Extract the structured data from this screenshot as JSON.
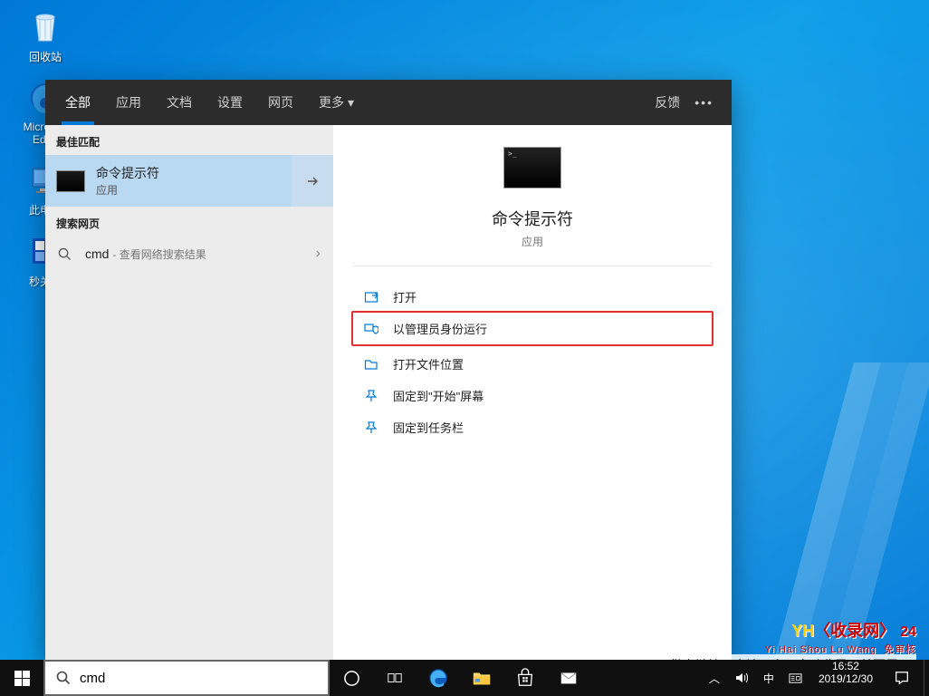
{
  "desktop": {
    "icons": [
      {
        "name": "recycle-bin",
        "label": "回收站"
      },
      {
        "name": "edge",
        "label": "Microsoft Edge"
      },
      {
        "name": "this-pc",
        "label": "此电脑"
      },
      {
        "name": "shutdown-app",
        "label": "秒关程"
      }
    ]
  },
  "search_panel": {
    "tabs": {
      "all": "全部",
      "apps": "应用",
      "docs": "文档",
      "settings": "设置",
      "web": "网页",
      "more": "更多"
    },
    "feedback": "反馈",
    "best_match_label": "最佳匹配",
    "best_match": {
      "title": "命令提示符",
      "subtitle": "应用"
    },
    "search_web_label": "搜索网页",
    "web_item": {
      "prefix": "cmd",
      "suffix": " - 查看网络搜索结果"
    },
    "app_detail": {
      "title": "命令提示符",
      "subtitle": "应用",
      "actions": {
        "open": "打开",
        "run_admin": "以管理员身份运行",
        "open_location": "打开文件位置",
        "pin_start": "固定到\"开始\"屏幕",
        "pin_taskbar": "固定到任务栏"
      }
    }
  },
  "taskbar": {
    "search_value": "cmd",
    "ime_lang": "中",
    "time": "16:52",
    "date": "2019/12/30"
  },
  "watermark": {
    "brand_yh": "YH",
    "brand_rest": "〈收录网〉",
    "pinyin": "Yi Hai Shou Lu Wang",
    "badge_top": "24",
    "badge_bottom": "免审核",
    "bar_text": "做上链接→来访→次→自动收录→首页展示"
  }
}
